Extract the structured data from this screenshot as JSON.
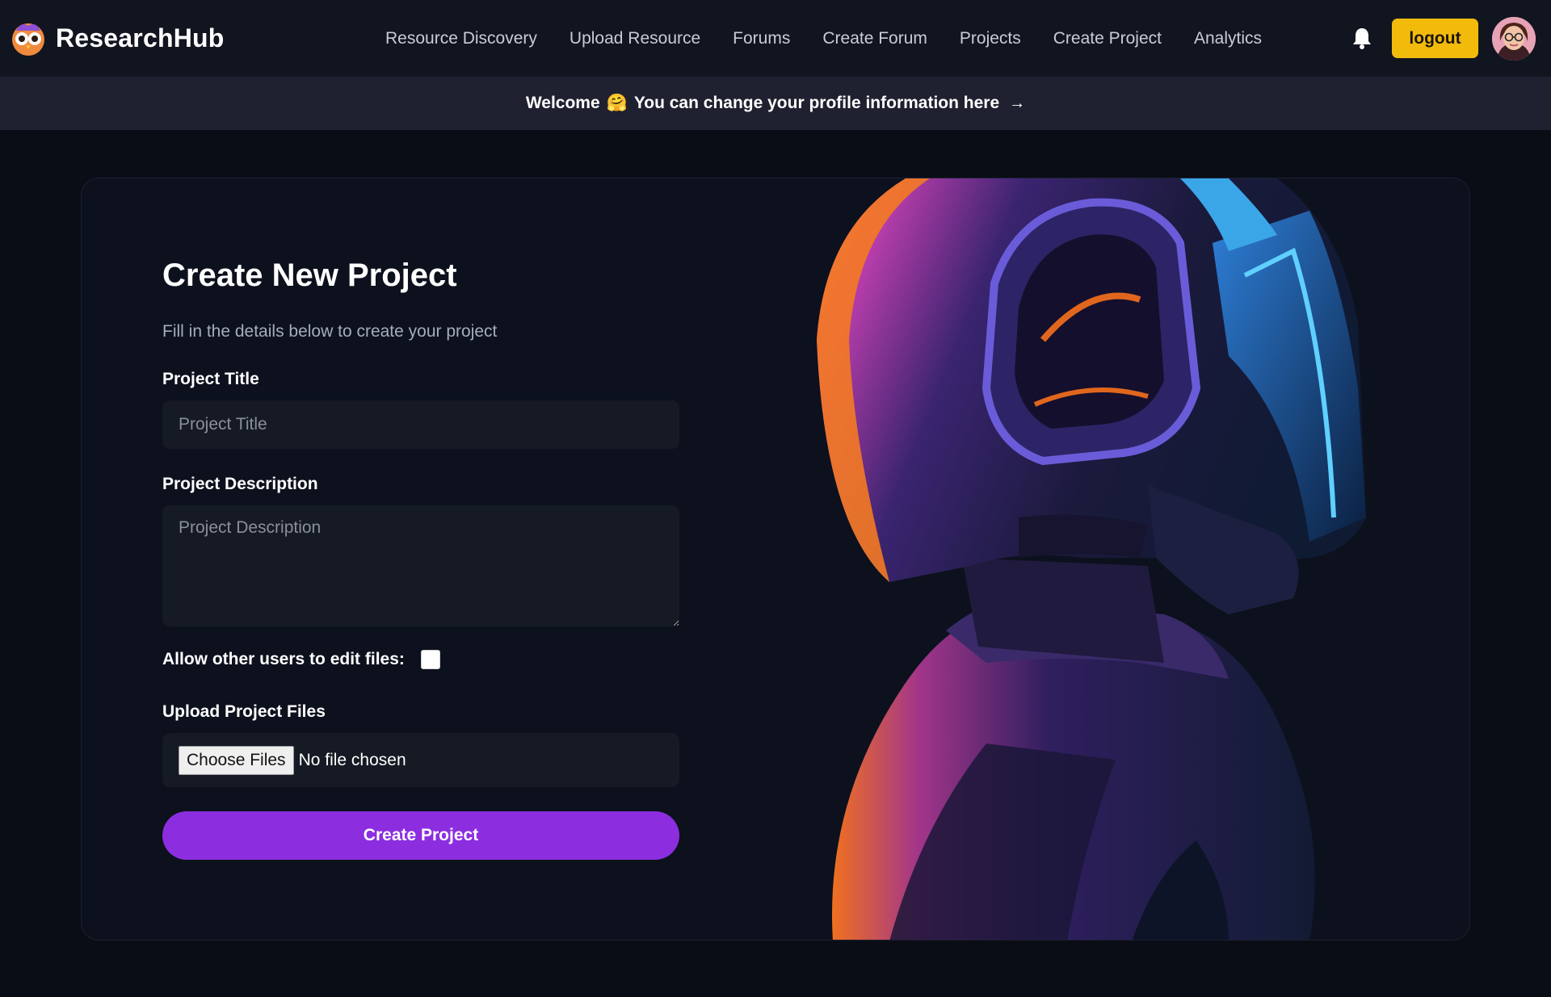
{
  "app": {
    "name": "ResearchHub"
  },
  "nav": {
    "links": [
      "Resource Discovery",
      "Upload Resource",
      "Forums",
      "Create Forum",
      "Projects",
      "Create Project",
      "Analytics"
    ],
    "notification_icon": "bell-icon",
    "logout_label": "logout",
    "accent_color": "#f2bb0c"
  },
  "banner": {
    "welcome": "Welcome",
    "emoji": "🤗",
    "message": "You can change your profile information here",
    "arrow": "→"
  },
  "form": {
    "title": "Create New Project",
    "subtitle": "Fill in the details below to create your project",
    "project_title_label": "Project Title",
    "project_title_placeholder": "Project Title",
    "project_title_value": "",
    "description_label": "Project Description",
    "description_placeholder": "Project Description",
    "description_value": "",
    "allow_edit_label": "Allow other users to edit files:",
    "allow_edit_checked": false,
    "upload_label": "Upload Project Files",
    "choose_files_label": "Choose Files",
    "file_status": "No file chosen",
    "submit_label": "Create Project",
    "submit_color": "#8c2ee0"
  }
}
